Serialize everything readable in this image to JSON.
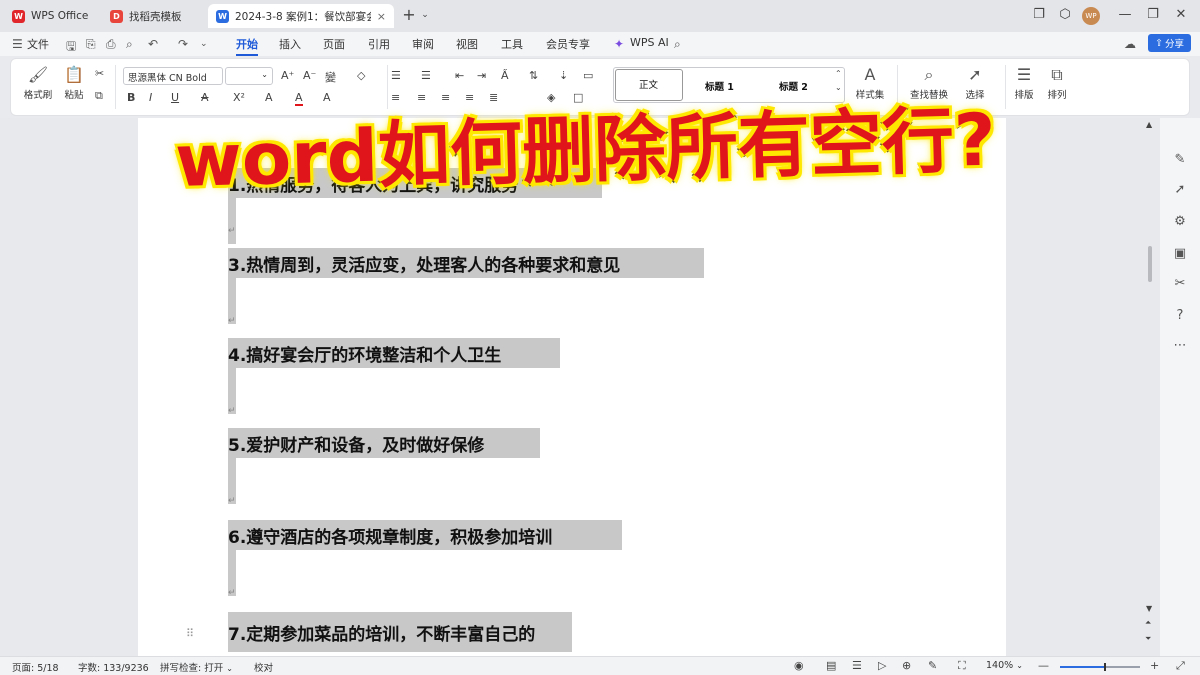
{
  "tabs": [
    {
      "label": "WPS Office",
      "icon": "wps-logo-icon",
      "color": "#e0262b"
    },
    {
      "label": "找稻壳模板",
      "icon": "docer-icon",
      "color": "#e8453c"
    },
    {
      "label": "2024-3-8 案例1：餐饮部宴会",
      "icon": "word-doc-icon",
      "color": "#2b6de0"
    }
  ],
  "new_tab": "+",
  "avatar_text": "WP",
  "menu": {
    "file": "文件",
    "items": [
      "开始",
      "插入",
      "页面",
      "引用",
      "审阅",
      "视图",
      "工具",
      "会员专享"
    ],
    "active": "开始",
    "wps_ai": "WPS AI",
    "share": "分享"
  },
  "ribbon": {
    "format_painter": "格式刷",
    "paste": "粘贴",
    "font_name": "思源黑体 CN Bold",
    "styles": [
      "正文",
      "标题 1",
      "标题 2"
    ],
    "style_set": "样式集",
    "find_replace": "查找替换",
    "select": "选择",
    "layout": "排版",
    "arrange": "排列"
  },
  "overlay_title": "word如何删除所有空行?",
  "document": {
    "paragraphs": [
      "1.热情服务，待客人为上宾，讲究服务",
      "3.热情周到，灵活应变，处理客人的各种要求和意见",
      "4.搞好宴会厅的环境整洁和个人卫生",
      "5.爱护财产和设备，及时做好保修",
      "6.遵守酒店的各项规章制度，积极参加培训",
      "7.定期参加菜品的培训，不断丰富自己的"
    ]
  },
  "status": {
    "page": "页面: 5/18",
    "words": "字数: 133/9236",
    "spell": "拼写检查: 打开",
    "proof": "校对",
    "zoom": "140%",
    "zoom_fraction": 0.55
  }
}
